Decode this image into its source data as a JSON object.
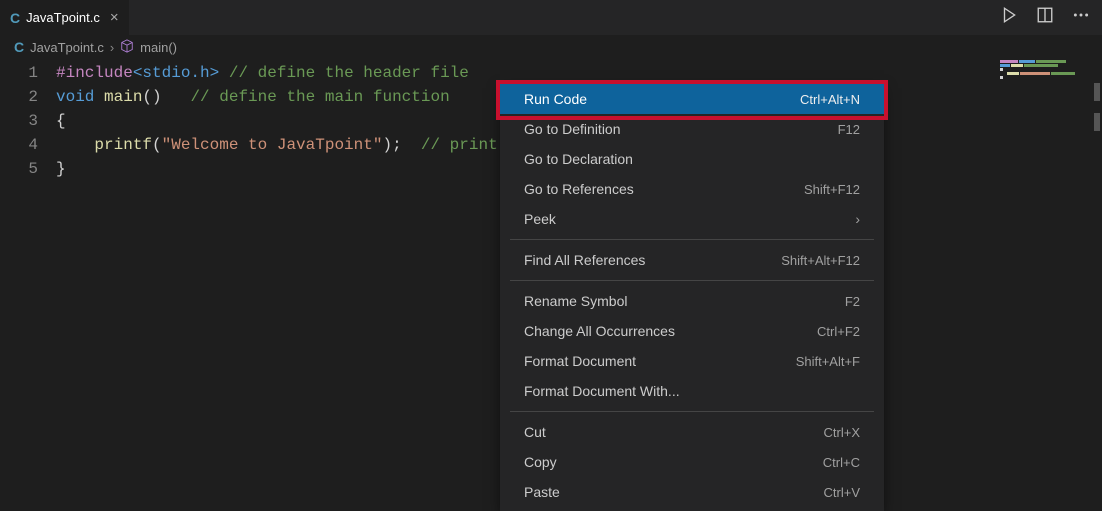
{
  "tab": {
    "icon_letter": "C",
    "filename": "JavaTpoint.c"
  },
  "breadcrumb": {
    "icon_letter": "C",
    "file": "JavaTpoint.c",
    "symbol": "main()"
  },
  "code": {
    "lines": [
      "1",
      "2",
      "3",
      "4",
      "5"
    ],
    "l1": {
      "macro": "#include",
      "angle": "<stdio.h>",
      "comment": "// define the header file"
    },
    "l2": {
      "kw": "void",
      "fn": "main",
      "paren": "()",
      "comment": "// define the main function"
    },
    "l3": {
      "brace": "{"
    },
    "l4": {
      "fn": "printf",
      "open": "(",
      "str": "\"Welcome to JavaTpoint\"",
      "close": ");",
      "comment": "// print"
    },
    "l5": {
      "brace": "}"
    }
  },
  "context_menu": {
    "items": [
      {
        "label": "Run Code",
        "shortcut": "Ctrl+Alt+N",
        "selected": true
      },
      {
        "label": "Go to Definition",
        "shortcut": "F12"
      },
      {
        "label": "Go to Declaration",
        "shortcut": ""
      },
      {
        "label": "Go to References",
        "shortcut": "Shift+F12"
      },
      {
        "label": "Peek",
        "submenu": true
      },
      {
        "sep": true
      },
      {
        "label": "Find All References",
        "shortcut": "Shift+Alt+F12"
      },
      {
        "sep": true
      },
      {
        "label": "Rename Symbol",
        "shortcut": "F2"
      },
      {
        "label": "Change All Occurrences",
        "shortcut": "Ctrl+F2"
      },
      {
        "label": "Format Document",
        "shortcut": "Shift+Alt+F"
      },
      {
        "label": "Format Document With...",
        "shortcut": ""
      },
      {
        "sep": true
      },
      {
        "label": "Cut",
        "shortcut": "Ctrl+X"
      },
      {
        "label": "Copy",
        "shortcut": "Ctrl+C"
      },
      {
        "label": "Paste",
        "shortcut": "Ctrl+V"
      }
    ]
  }
}
